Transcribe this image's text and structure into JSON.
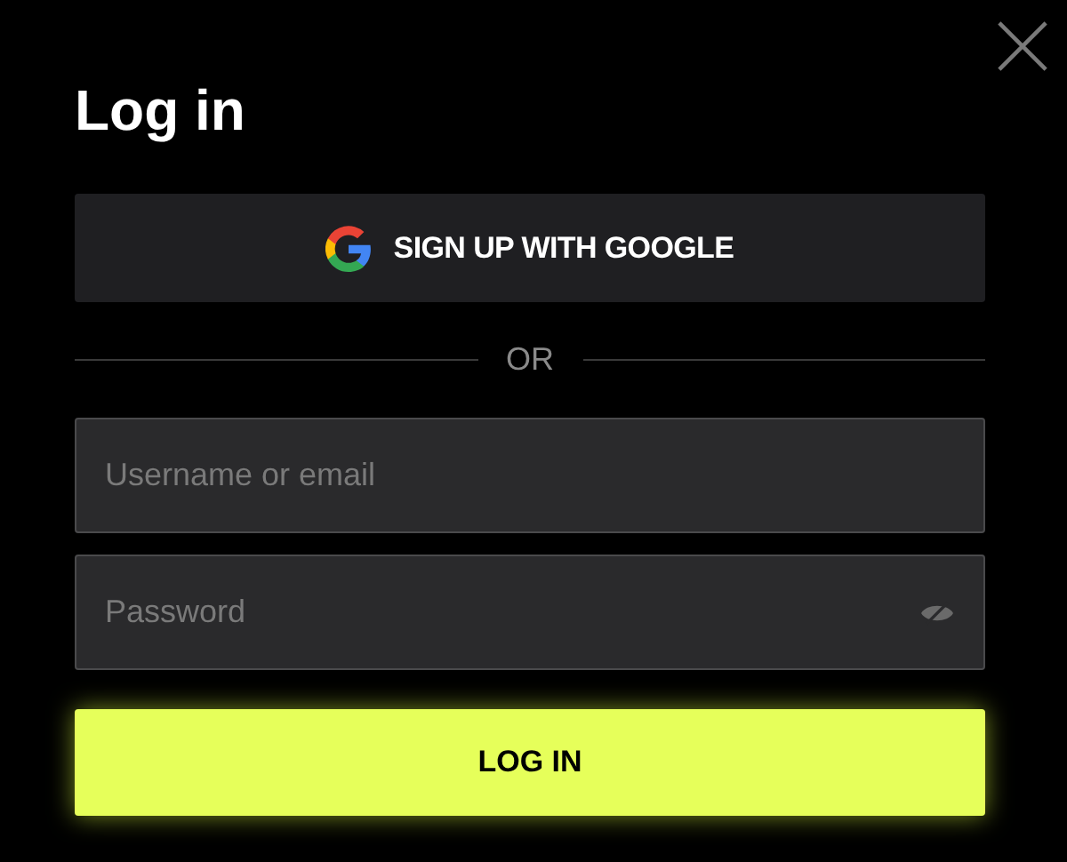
{
  "title": "Log in",
  "google_button": {
    "label": "SIGN UP WITH GOOGLE"
  },
  "divider": {
    "label": "OR"
  },
  "fields": [
    {
      "kind": "text",
      "placeholder": "Username or email"
    },
    {
      "kind": "password",
      "placeholder": "Password"
    }
  ],
  "submit_button": {
    "label": "LOG IN"
  }
}
